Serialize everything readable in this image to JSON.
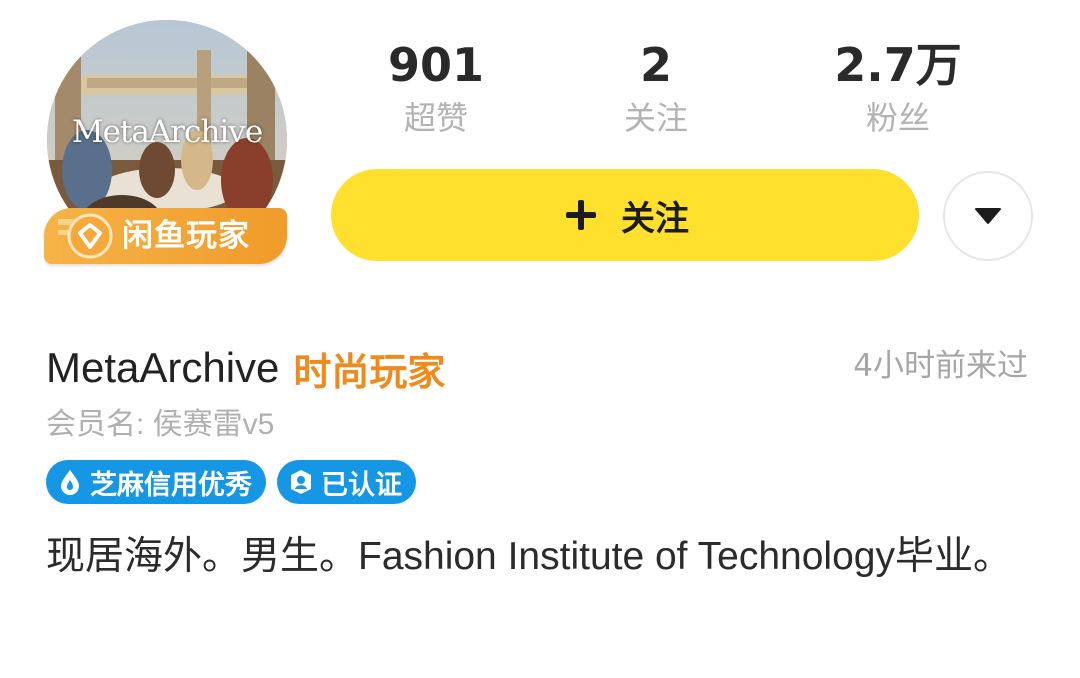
{
  "avatar": {
    "overlay_text": "MetaArchive",
    "badge_label": "闲鱼玩家",
    "badge_icon": "xianyu-emblem-icon"
  },
  "stats": [
    {
      "value": "901",
      "label": "超赞"
    },
    {
      "value": "2",
      "label": "关注"
    },
    {
      "value": "2.7万",
      "label": "粉丝"
    }
  ],
  "actions": {
    "follow_label": "关注",
    "follow_icon": "plus-icon",
    "more_icon": "caret-down-icon"
  },
  "profile": {
    "username": "MetaArchive",
    "tag": "时尚玩家",
    "last_visit": "4小时前来过",
    "member_name": "会员名: 侯赛雷v5",
    "badges": [
      {
        "label": "芝麻信用优秀",
        "icon": "sesame-credit-icon"
      },
      {
        "label": "已认证",
        "icon": "verified-user-icon"
      }
    ],
    "bio": "现居海外。男生。Fashion Institute of Technology毕业。"
  },
  "colors": {
    "accent_yellow": "#ffe02c",
    "badge_orange": "#f09b2a",
    "tag_orange": "#f08a1c",
    "badge_blue": "#1597e5",
    "muted_gray": "#b3b3b3"
  }
}
